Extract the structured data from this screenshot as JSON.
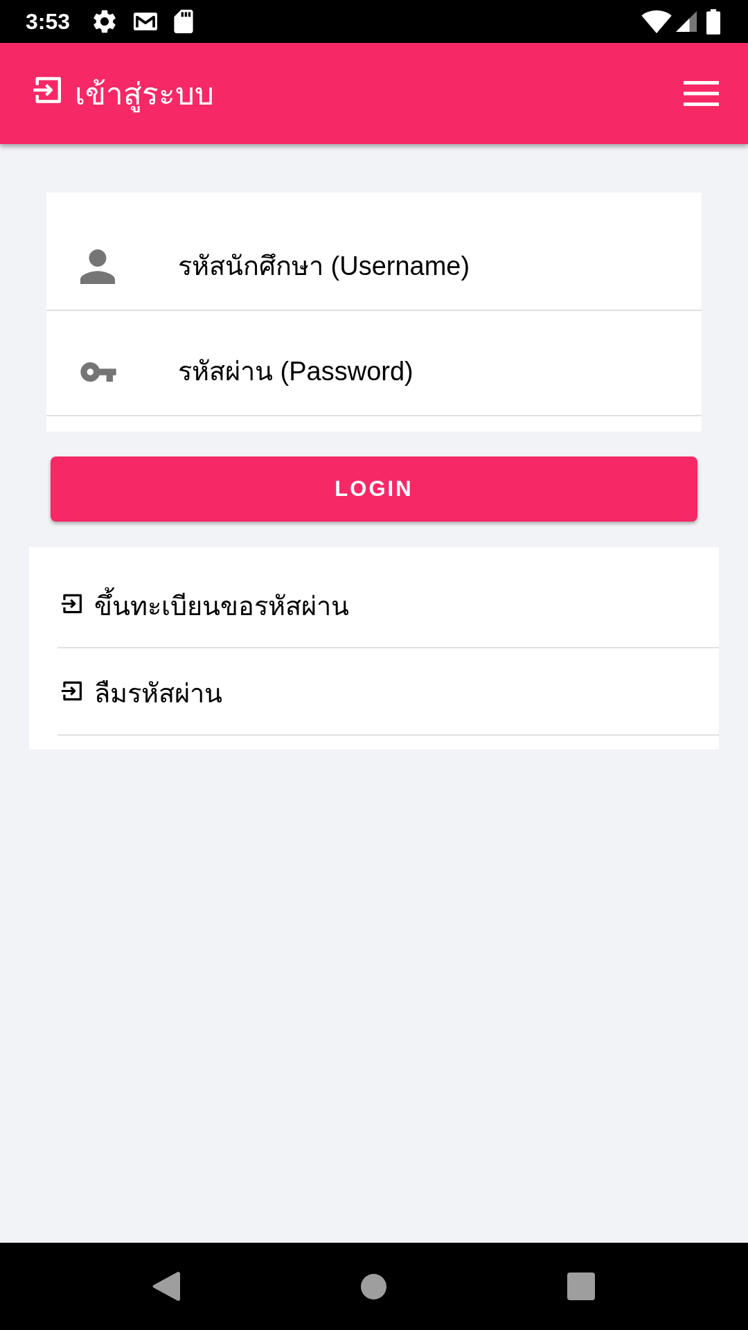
{
  "status_bar": {
    "time": "3:53"
  },
  "app_bar": {
    "title": "เข้าสู่ระบบ"
  },
  "login_form": {
    "fields": [
      {
        "kind": "username",
        "placeholder": "รหัสนักศึกษา (Username)"
      },
      {
        "kind": "password",
        "placeholder": "รหัสผ่าน (Password)"
      }
    ],
    "button": "LOGIN"
  },
  "links": [
    {
      "label": "ขึ้นทะเบียนขอรหัสผ่าน"
    },
    {
      "label": "ลืมรหัสผ่าน"
    }
  ]
}
